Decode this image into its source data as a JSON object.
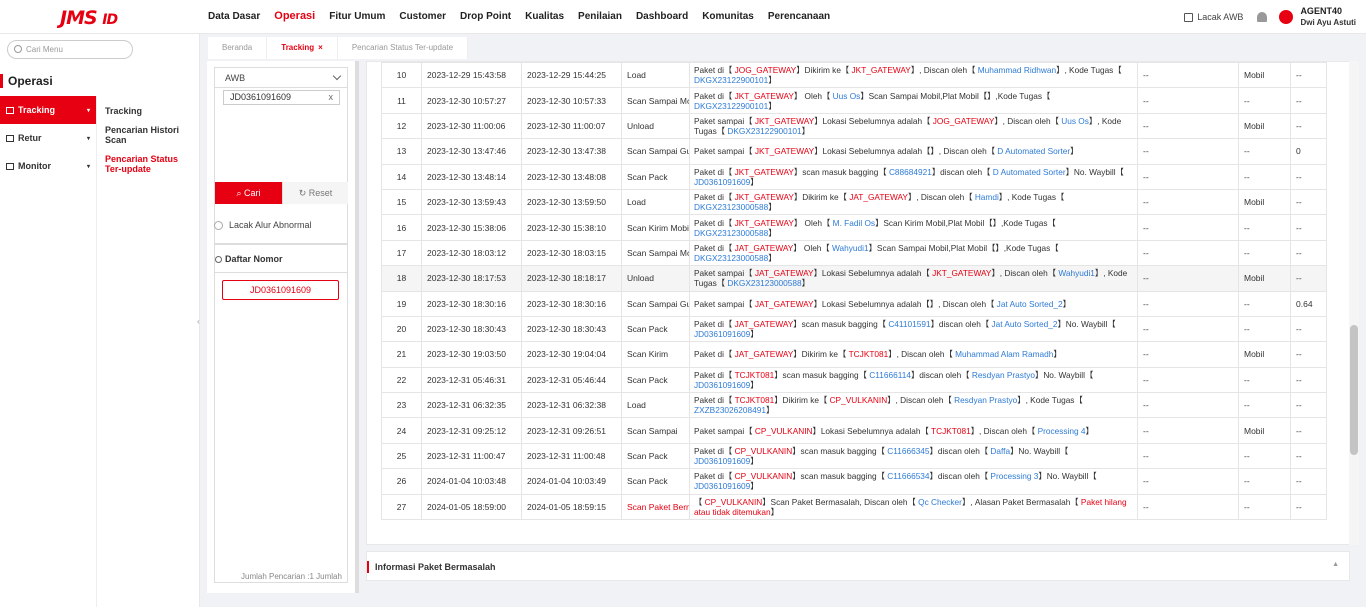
{
  "header": {
    "logo": "JMS",
    "logo_suffix": "ID",
    "nav": [
      "Data Dasar",
      "Operasi",
      "Fitur Umum",
      "Customer",
      "Drop Point",
      "Kualitas",
      "Penilaian",
      "Dashboard",
      "Komunitas",
      "Perencanaan"
    ],
    "nav_active": "Operasi",
    "lacak_awb": "Lacak AWB",
    "user_id": "AGENT40",
    "user_name": "Dwi Ayu Astuti"
  },
  "sidebar": {
    "search_placeholder": "Cari Menu",
    "section": "Operasi",
    "left_items": [
      {
        "label": "Tracking",
        "active": true
      },
      {
        "label": "Retur",
        "active": false
      },
      {
        "label": "Monitor",
        "active": false
      }
    ],
    "right_items": [
      {
        "label": "Tracking",
        "active": false
      },
      {
        "label": "Pencarian Histori Scan",
        "active": false
      },
      {
        "label": "Pencarian Status Ter-update",
        "active": true
      }
    ]
  },
  "tabs": [
    {
      "label": "Beranda",
      "active": false
    },
    {
      "label": "Tracking",
      "active": true,
      "closable": true
    },
    {
      "label": "Pencarian Status Ter-update",
      "active": false
    }
  ],
  "search_panel": {
    "type_select": "AWB",
    "awb_value": "JD0361091609",
    "cari_label": "Cari",
    "reset_label": "Reset",
    "radio_label": "Lacak Alur Abnormal",
    "daftar_title": "Daftar Nomor",
    "number_item": "JD0361091609",
    "jumlah": "Jumlah Pencarian :1  Jumlah"
  },
  "tracking_rows": [
    {
      "no": "10",
      "t1": "2023-12-29 15:43:58",
      "t2": "2023-12-29 15:44:25",
      "type": "Load",
      "segs": [
        [
          "Paket di【 "
        ],
        [
          "JOG_GATEWAY",
          "r"
        ],
        [
          "】Dikirim ke【 "
        ],
        [
          "JKT_GATEWAY",
          "r"
        ],
        [
          "】, Discan oleh【 "
        ],
        [
          "Muhammad Ridhwan",
          "b"
        ],
        [
          "】, Kode Tugas【 "
        ],
        [
          "DKGX23122900101",
          "b"
        ],
        [
          "】"
        ]
      ],
      "c6": "Mobil",
      "c7": "--"
    },
    {
      "no": "11",
      "t1": "2023-12-30 10:57:27",
      "t2": "2023-12-30 10:57:33",
      "type": "Scan Sampai Mobil",
      "segs": [
        [
          "Paket di【 "
        ],
        [
          "JKT_GATEWAY",
          "r"
        ],
        [
          "】 Oleh【 "
        ],
        [
          "Uus Os",
          "b"
        ],
        [
          "】Scan Sampai Mobil,Plat Mobil【】,Kode Tugas【 "
        ],
        [
          "DKGX23122900101",
          "b"
        ],
        [
          "】"
        ]
      ],
      "c6": "--",
      "c7": "--"
    },
    {
      "no": "12",
      "t1": "2023-12-30 11:00:06",
      "t2": "2023-12-30 11:00:07",
      "type": "Unload",
      "segs": [
        [
          "Paket sampai【 "
        ],
        [
          "JKT_GATEWAY",
          "r"
        ],
        [
          "】Lokasi Sebelumnya adalah【 "
        ],
        [
          "JOG_GATEWAY",
          "r"
        ],
        [
          "】, Discan oleh【 "
        ],
        [
          "Uus Os",
          "b"
        ],
        [
          "】, Kode Tugas【 "
        ],
        [
          "DKGX23122900101",
          "b"
        ],
        [
          "】"
        ]
      ],
      "c6": "Mobil",
      "c7": "--"
    },
    {
      "no": "13",
      "t1": "2023-12-30 13:47:46",
      "t2": "2023-12-30 13:47:38",
      "type": "Scan Sampai Gudang",
      "segs": [
        [
          "Paket sampai【 "
        ],
        [
          "JKT_GATEWAY",
          "r"
        ],
        [
          "】Lokasi Sebelumnya adalah【】, Discan oleh【 "
        ],
        [
          "D Automated Sorter",
          "b"
        ],
        [
          "】"
        ]
      ],
      "c6": "--",
      "c7": "0"
    },
    {
      "no": "14",
      "t1": "2023-12-30 13:48:14",
      "t2": "2023-12-30 13:48:08",
      "type": "Scan Pack",
      "segs": [
        [
          "Paket di【 "
        ],
        [
          "JKT_GATEWAY",
          "r"
        ],
        [
          "】scan masuk bagging【 "
        ],
        [
          "C88684921",
          "b"
        ],
        [
          "】discan oleh【 "
        ],
        [
          "D Automated Sorter",
          "b"
        ],
        [
          "】No. Waybill【 "
        ],
        [
          "JD0361091609",
          "b"
        ],
        [
          "】"
        ]
      ],
      "c6": "--",
      "c7": "--"
    },
    {
      "no": "15",
      "t1": "2023-12-30 13:59:43",
      "t2": "2023-12-30 13:59:50",
      "type": "Load",
      "segs": [
        [
          "Paket di【 "
        ],
        [
          "JKT_GATEWAY",
          "r"
        ],
        [
          "】Dikirim ke【 "
        ],
        [
          "JAT_GATEWAY",
          "r"
        ],
        [
          "】, Discan oleh【 "
        ],
        [
          "Hamdi",
          "b"
        ],
        [
          "】, Kode Tugas【 "
        ],
        [
          "DKGX23123000588",
          "b"
        ],
        [
          "】"
        ]
      ],
      "c6": "Mobil",
      "c7": "--"
    },
    {
      "no": "16",
      "t1": "2023-12-30 15:38:06",
      "t2": "2023-12-30 15:38:10",
      "type": "Scan Kirim Mobil",
      "segs": [
        [
          "Paket di【 "
        ],
        [
          "JKT_GATEWAY",
          "r"
        ],
        [
          "】 Oleh【 "
        ],
        [
          "M. Fadil Os",
          "b"
        ],
        [
          "】Scan Kirim Mobil,Plat Mobil【】,Kode Tugas【 "
        ],
        [
          "DKGX23123000588",
          "b"
        ],
        [
          "】"
        ]
      ],
      "c6": "--",
      "c7": "--"
    },
    {
      "no": "17",
      "t1": "2023-12-30 18:03:12",
      "t2": "2023-12-30 18:03:15",
      "type": "Scan Sampai Mobil",
      "segs": [
        [
          "Paket di【 "
        ],
        [
          "JAT_GATEWAY",
          "r"
        ],
        [
          "】 Oleh【 "
        ],
        [
          "Wahyudi1",
          "b"
        ],
        [
          "】Scan Sampai Mobil,Plat Mobil【】,Kode Tugas【 "
        ],
        [
          "DKGX23123000588",
          "b"
        ],
        [
          "】"
        ]
      ],
      "c6": "--",
      "c7": "--"
    },
    {
      "no": "18",
      "t1": "2023-12-30 18:17:53",
      "t2": "2023-12-30 18:18:17",
      "type": "Unload",
      "segs": [
        [
          "Paket sampai【 "
        ],
        [
          "JAT_GATEWAY",
          "r"
        ],
        [
          "】Lokasi Sebelumnya adalah【 "
        ],
        [
          "JKT_GATEWAY",
          "r"
        ],
        [
          "】, Discan oleh【 "
        ],
        [
          "Wahyudi1",
          "b"
        ],
        [
          "】, Kode Tugas【 "
        ],
        [
          "DKGX23123000588",
          "b"
        ],
        [
          "】"
        ]
      ],
      "c6": "Mobil",
      "c7": "--",
      "hl": true
    },
    {
      "no": "19",
      "t1": "2023-12-30 18:30:16",
      "t2": "2023-12-30 18:30:16",
      "type": "Scan Sampai Gudang",
      "segs": [
        [
          "Paket sampai【 "
        ],
        [
          "JAT_GATEWAY",
          "r"
        ],
        [
          "】Lokasi Sebelumnya adalah【】, Discan oleh【 "
        ],
        [
          "Jat Auto Sorted_2",
          "b"
        ],
        [
          "】"
        ]
      ],
      "c6": "--",
      "c7": "0.64"
    },
    {
      "no": "20",
      "t1": "2023-12-30 18:30:43",
      "t2": "2023-12-30 18:30:43",
      "type": "Scan Pack",
      "segs": [
        [
          "Paket di【 "
        ],
        [
          "JAT_GATEWAY",
          "r"
        ],
        [
          "】scan masuk bagging【 "
        ],
        [
          "C41101591",
          "b"
        ],
        [
          "】discan oleh【 "
        ],
        [
          "Jat Auto Sorted_2",
          "b"
        ],
        [
          "】No. Waybill【 "
        ],
        [
          "JD0361091609",
          "b"
        ],
        [
          "】"
        ]
      ],
      "c6": "--",
      "c7": "--"
    },
    {
      "no": "21",
      "t1": "2023-12-30 19:03:50",
      "t2": "2023-12-30 19:04:04",
      "type": "Scan Kirim",
      "segs": [
        [
          "Paket di【 "
        ],
        [
          "JAT_GATEWAY",
          "r"
        ],
        [
          "】Dikirim ke【 "
        ],
        [
          "TCJKT081",
          "r"
        ],
        [
          "】, Discan oleh【 "
        ],
        [
          "Muhammad Alam Ramadh",
          "b"
        ],
        [
          "】"
        ]
      ],
      "c6": "Mobil",
      "c7": "--"
    },
    {
      "no": "22",
      "t1": "2023-12-31 05:46:31",
      "t2": "2023-12-31 05:46:44",
      "type": "Scan Pack",
      "segs": [
        [
          "Paket di【 "
        ],
        [
          "TCJKT081",
          "r"
        ],
        [
          "】scan masuk bagging【 "
        ],
        [
          "C11666114",
          "b"
        ],
        [
          "】discan oleh【 "
        ],
        [
          "Resdyan Prastyo",
          "b"
        ],
        [
          "】No. Waybill【 "
        ],
        [
          "JD0361091609",
          "b"
        ],
        [
          "】"
        ]
      ],
      "c6": "--",
      "c7": "--"
    },
    {
      "no": "23",
      "t1": "2023-12-31 06:32:35",
      "t2": "2023-12-31 06:32:38",
      "type": "Load",
      "segs": [
        [
          "Paket di【 "
        ],
        [
          "TCJKT081",
          "r"
        ],
        [
          "】Dikirim ke【 "
        ],
        [
          "CP_VULKANIN",
          "r"
        ],
        [
          "】, Discan oleh【 "
        ],
        [
          "Resdyan Prastyo",
          "b"
        ],
        [
          "】, Kode Tugas【 "
        ],
        [
          "ZXZB23026208491",
          "b"
        ],
        [
          "】"
        ]
      ],
      "c6": "--",
      "c7": "--"
    },
    {
      "no": "24",
      "t1": "2023-12-31 09:25:12",
      "t2": "2023-12-31 09:26:51",
      "type": "Scan Sampai",
      "segs": [
        [
          "Paket sampai【 "
        ],
        [
          "CP_VULKANIN",
          "r"
        ],
        [
          "】Lokasi Sebelumnya adalah【 "
        ],
        [
          "TCJKT081",
          "r"
        ],
        [
          "】, Discan oleh【 "
        ],
        [
          "Processing 4",
          "b"
        ],
        [
          "】"
        ]
      ],
      "c6": "Mobil",
      "c7": "--"
    },
    {
      "no": "25",
      "t1": "2023-12-31 11:00:47",
      "t2": "2023-12-31 11:00:48",
      "type": "Scan Pack",
      "segs": [
        [
          "Paket di【 "
        ],
        [
          "CP_VULKANIN",
          "r"
        ],
        [
          "】scan masuk bagging【 "
        ],
        [
          "C11666345",
          "b"
        ],
        [
          "】discan oleh【 "
        ],
        [
          "Daffa",
          "b"
        ],
        [
          "】No. Waybill【 "
        ],
        [
          "JD0361091609",
          "b"
        ],
        [
          "】"
        ]
      ],
      "c6": "--",
      "c7": "--"
    },
    {
      "no": "26",
      "t1": "2024-01-04 10:03:48",
      "t2": "2024-01-04 10:03:49",
      "type": "Scan Pack",
      "segs": [
        [
          "Paket di【 "
        ],
        [
          "CP_VULKANIN",
          "r"
        ],
        [
          "】scan masuk bagging【 "
        ],
        [
          "C11666534",
          "b"
        ],
        [
          "】discan oleh【 "
        ],
        [
          "Processing 3",
          "b"
        ],
        [
          "】No. Waybill【 "
        ],
        [
          "JD0361091609",
          "b"
        ],
        [
          "】"
        ]
      ],
      "c6": "--",
      "c7": "--"
    },
    {
      "no": "27",
      "t1": "2024-01-05 18:59:00",
      "t2": "2024-01-05 18:59:15",
      "type": "Scan Paket Bermasalah",
      "type_red": true,
      "segs": [
        [
          "【 "
        ],
        [
          "CP_VULKANIN",
          "r"
        ],
        [
          "】Scan Paket Bermasalah, Discan oleh【 "
        ],
        [
          "Qc Checker",
          "b"
        ],
        [
          "】, Alasan Paket Bermasalah【 "
        ],
        [
          "Paket hilang atau tidak ditemukan",
          "rr"
        ],
        [
          "】"
        ]
      ],
      "c6": "--",
      "c7": "--"
    }
  ],
  "row_common": {
    "c5": "--"
  },
  "bottom_panel": {
    "title": "Informasi Paket Bermasalah"
  },
  "colors": {
    "brand_red": "#e60012",
    "link_blue": "#2e7bd6"
  }
}
